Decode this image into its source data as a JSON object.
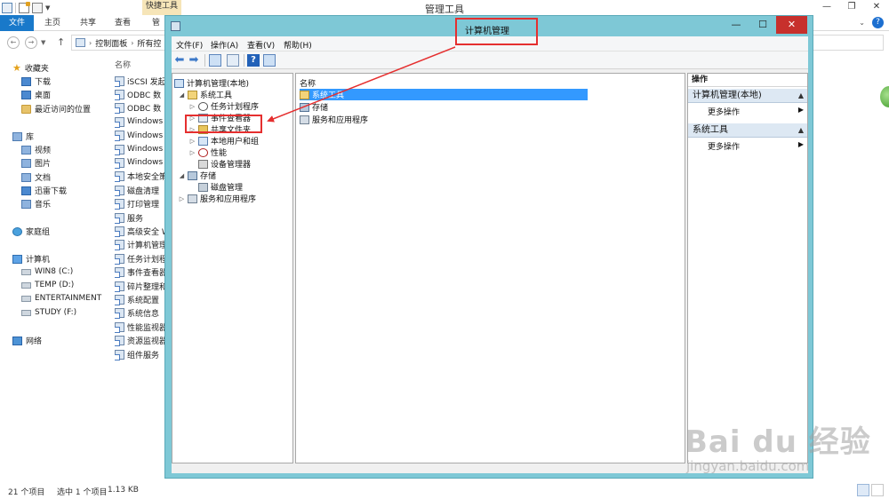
{
  "explorer": {
    "title": "管理工具",
    "contextual_tab": "快捷工具",
    "tabs": [
      "文件",
      "主页",
      "共享",
      "查看",
      "管"
    ],
    "address": [
      "控制面板",
      "所有控"
    ],
    "nav": {
      "favorites": "收藏夹",
      "favorites_items": [
        "下载",
        "桌面",
        "最近访问的位置"
      ],
      "libraries": "库",
      "libraries_items": [
        "视频",
        "图片",
        "文档",
        "迅雷下载",
        "音乐"
      ],
      "homegroup": "家庭组",
      "computer": "计算机",
      "drives": [
        "WIN8 (C:)",
        "TEMP (D:)",
        "ENTERTAINMENT",
        "STUDY (F:)"
      ],
      "network": "网络"
    },
    "files_header": "名称",
    "files": [
      "iSCSI 发起",
      "ODBC 数",
      "ODBC 数",
      "Windows",
      "Windows",
      "Windows",
      "Windows",
      "本地安全策",
      "磁盘清理",
      "打印管理",
      "服务",
      "高级安全 W",
      "计算机管理",
      "任务计划程",
      "事件查看器",
      "碎片整理和",
      "系统配置",
      "系统信息",
      "性能监视器",
      "资源监视器",
      "组件服务"
    ],
    "status": {
      "count": "21 个项目",
      "selected": "选中 1 个项目",
      "size": "1.13 KB"
    }
  },
  "mmc": {
    "title": "计算机管理",
    "menu": [
      "文件(F)",
      "操作(A)",
      "查看(V)",
      "帮助(H)"
    ],
    "tree": {
      "root": "计算机管理(本地)",
      "system_tools": "系统工具",
      "task_scheduler": "任务计划程序",
      "event_viewer": "事件查看器",
      "shared_folders": "共享文件夹",
      "local_users": "本地用户和组",
      "performance": "性能",
      "device_manager": "设备管理器",
      "storage": "存储",
      "disk_management": "磁盘管理",
      "services_apps": "服务和应用程序"
    },
    "list": {
      "header": "名称",
      "rows": [
        "系统工具",
        "存储",
        "服务和应用程序"
      ],
      "selected_index": 0
    },
    "actions": {
      "header": "操作",
      "group1": "计算机管理(本地)",
      "group1_item": "更多操作",
      "group2": "系统工具",
      "group2_item": "更多操作"
    }
  },
  "watermark": {
    "logo": "Bai du 经验",
    "url": "jingyan.baidu.com"
  },
  "colors": {
    "callout": "#e52f2f",
    "window_frame": "#7ec8d6",
    "selection": "#3399ff",
    "file_tab": "#1979ca",
    "close_button": "#c7302c"
  }
}
